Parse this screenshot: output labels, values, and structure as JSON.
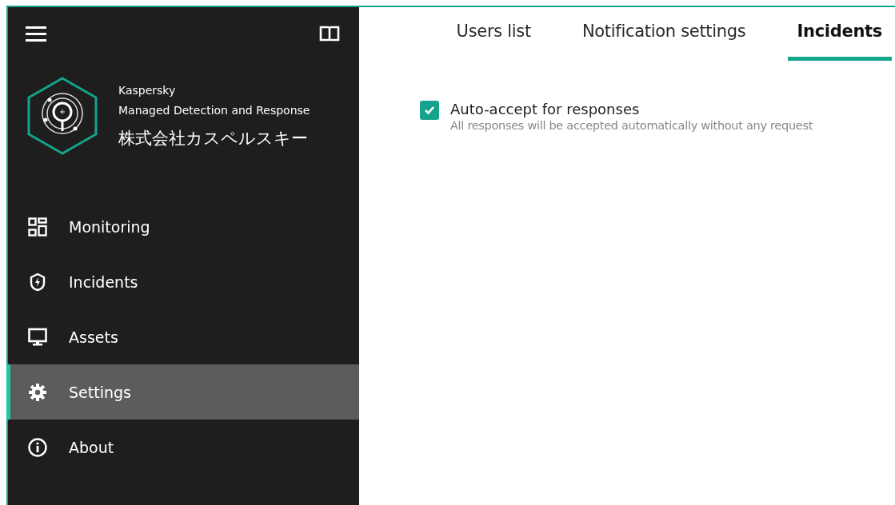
{
  "sidebar": {
    "product": {
      "vendor": "Kaspersky",
      "name": "Managed Detection and Response",
      "company": "株式会社カスペルスキー"
    },
    "items": [
      {
        "label": "Monitoring",
        "kind": "grid",
        "selected": false
      },
      {
        "label": "Incidents",
        "kind": "shield",
        "selected": false
      },
      {
        "label": "Assets",
        "kind": "monitor",
        "selected": false
      },
      {
        "label": "Settings",
        "kind": "gear",
        "selected": true
      },
      {
        "label": "About",
        "kind": "info",
        "selected": false
      }
    ]
  },
  "tabs": [
    {
      "label": "Users list",
      "selected": false
    },
    {
      "label": "Notification settings",
      "selected": false
    },
    {
      "label": "Incidents",
      "selected": true
    }
  ],
  "options": [
    {
      "label": "Auto-accept for responses",
      "description": "All responses will be accepted automatically without any request",
      "checked": true
    }
  ]
}
